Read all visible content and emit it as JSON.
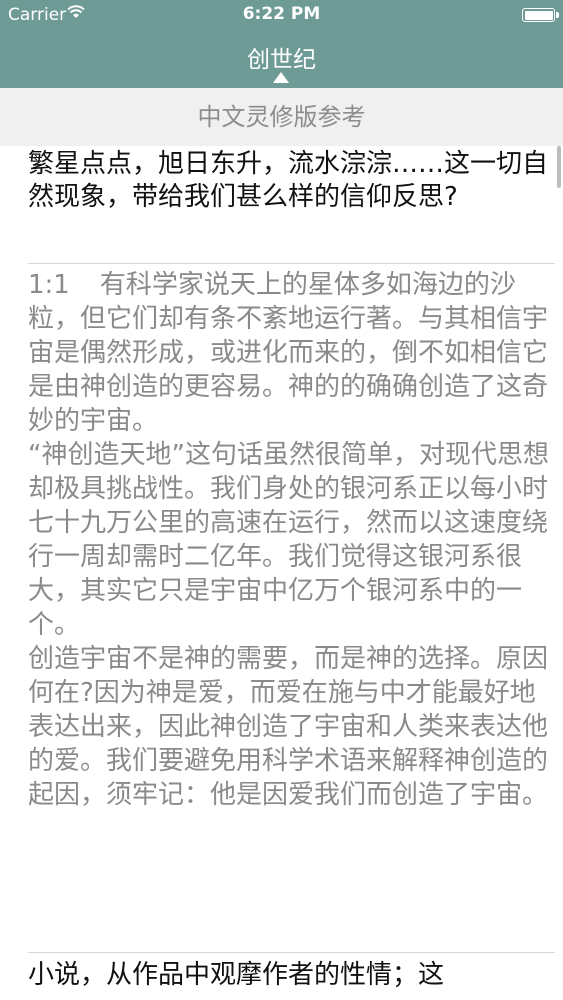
{
  "status_bar": {
    "carrier": "Carrier",
    "time": "6:22 PM",
    "wifi_icon": "wifi-icon",
    "battery_icon": "battery-icon"
  },
  "nav": {
    "title": "创世纪",
    "caret_icon": "caret-up-icon"
  },
  "subheader": {
    "label": "中文灵修版参考"
  },
  "content": {
    "question": "繁星点点，旭日东升，流水淙淙……这一切自然现象，带给我们甚么样的信仰反思?",
    "verse_number": "1:1",
    "paragraph1": "有科学家说天上的星体多如海边的沙粒，但它们却有条不紊地运行著。与其相信宇宙是偶然形成，或进化而来的，倒不如相信它是由神创造的更容易。神的的确确创造了这奇妙的宇宙。",
    "paragraph2": "“神创造天地”这句话虽然很简单，对现代思想却极具挑战性。我们身处的银河系正以每小时七十九万公里的高速在运行，然而以这速度绕行一周却需时二亿年。我们觉得这银河系很大，其实它只是宇宙中亿万个银河系中的一个。",
    "paragraph3": "创造宇宙不是神的需要，而是神的选择。原因何在?因为神是爱，而爱在施与中才能最好地表达出来，因此神创造了宇宙和人类来表达他的爱。我们要避免用科学术语来解释神创造的起因，须牢记：他是因爱我们而创造了宇宙。",
    "next_line": "小说，从作品中观摩作者的性情；这"
  },
  "colors": {
    "header_bg": "#6e9b96",
    "subheader_bg": "#f0f0f0",
    "verse_text": "#8a8a8a"
  }
}
